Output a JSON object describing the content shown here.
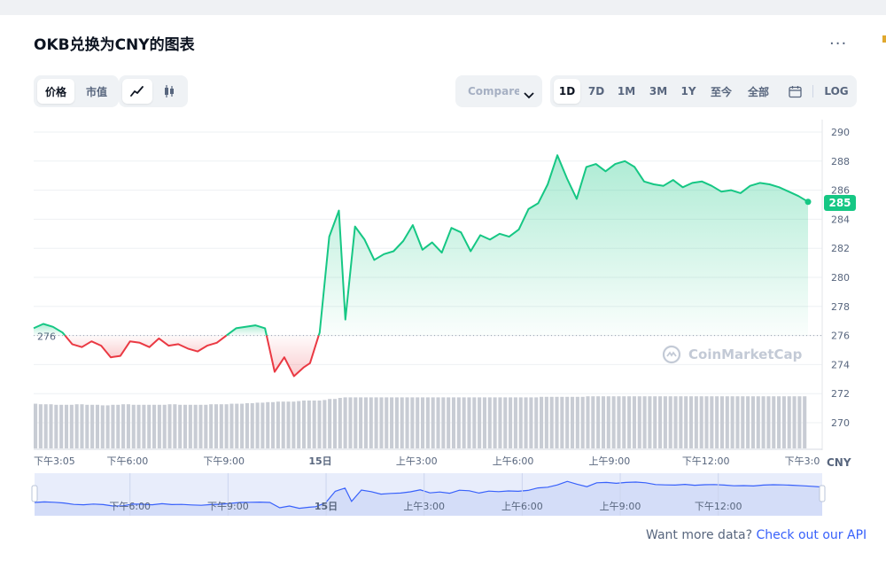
{
  "title": "OKB兑换为CNY的图表",
  "more_label": "...",
  "controls": {
    "metric_tabs": [
      "价格",
      "市值"
    ],
    "active_metric": "价格",
    "chart_style_icons": [
      "line-chart-icon",
      "candlestick-icon"
    ],
    "compare_placeholder": "Compare with",
    "range_tabs": [
      "1D",
      "7D",
      "1M",
      "3M",
      "1Y",
      "至今",
      "全部"
    ],
    "active_range": "1D",
    "log_label": "LOG"
  },
  "watermark": "CoinMarketCap",
  "footer": {
    "text": "Want more data? ",
    "link": "Check out our API"
  },
  "colors": {
    "up": "#16c784",
    "down": "#ea3943",
    "accent": "#3861fb",
    "volume": "#c8ccd4",
    "navigator": "#e8edfb"
  },
  "chart_data": {
    "type": "line",
    "currency": "CNY",
    "baseline": 276,
    "baseline_label": "276",
    "current_price": 285,
    "current_price_label": "285",
    "ylim": [
      268,
      291
    ],
    "y_ticks": [
      270,
      272,
      274,
      276,
      278,
      280,
      282,
      284,
      286,
      288,
      290
    ],
    "x_tick_labels": [
      "下午3:05",
      "下午6:00",
      "下午9:00",
      "15日",
      "上午3:00",
      "上午6:00",
      "上午9:00",
      "下午12:00",
      "下午3:0"
    ],
    "x_tick_hours": [
      0,
      2.92,
      5.92,
      8.92,
      11.92,
      14.92,
      17.92,
      20.92,
      23.92
    ],
    "x_hours": [
      0,
      0.3,
      0.6,
      0.9,
      1.2,
      1.5,
      1.8,
      2.1,
      2.4,
      2.7,
      3.0,
      3.3,
      3.6,
      3.9,
      4.2,
      4.5,
      4.8,
      5.1,
      5.4,
      5.7,
      6.0,
      6.3,
      6.6,
      6.9,
      7.2,
      7.5,
      7.8,
      8.1,
      8.4,
      8.6,
      8.9,
      9.2,
      9.5,
      9.7,
      10.0,
      10.3,
      10.6,
      10.9,
      11.2,
      11.5,
      11.8,
      12.1,
      12.4,
      12.7,
      13.0,
      13.3,
      13.6,
      13.9,
      14.2,
      14.5,
      14.8,
      15.1,
      15.4,
      15.7,
      16.0,
      16.3,
      16.6,
      16.9,
      17.2,
      17.5,
      17.8,
      18.1,
      18.4,
      18.7,
      19.0,
      19.3,
      19.6,
      19.9,
      20.2,
      20.5,
      20.8,
      21.1,
      21.4,
      21.7,
      22.0,
      22.3,
      22.6,
      22.9,
      23.2,
      23.5,
      23.8,
      24.1
    ],
    "y_values": [
      276.5,
      276.8,
      276.6,
      276.2,
      275.4,
      275.2,
      275.6,
      275.3,
      274.5,
      274.6,
      275.6,
      275.5,
      275.2,
      275.8,
      275.3,
      275.4,
      275.1,
      274.9,
      275.3,
      275.5,
      276.0,
      276.5,
      276.6,
      276.7,
      276.5,
      273.5,
      274.5,
      273.2,
      273.8,
      274.1,
      276.2,
      282.8,
      284.6,
      277.1,
      283.5,
      282.6,
      281.2,
      281.6,
      281.8,
      282.5,
      283.6,
      281.9,
      282.4,
      281.7,
      283.4,
      283.1,
      281.8,
      282.9,
      282.6,
      283.0,
      282.8,
      283.3,
      284.7,
      285.1,
      286.4,
      288.4,
      286.8,
      285.4,
      287.6,
      287.8,
      287.3,
      287.8,
      288.0,
      287.6,
      286.6,
      286.4,
      286.3,
      286.7,
      286.2,
      286.5,
      286.6,
      286.3,
      285.9,
      286.0,
      285.8,
      286.3,
      286.5,
      286.4,
      286.2,
      285.9,
      285.6,
      285.2
    ],
    "volume_relative": [
      0.84,
      0.83,
      0.83,
      0.82,
      0.82,
      0.83,
      0.82,
      0.82,
      0.81,
      0.82,
      0.83,
      0.82,
      0.82,
      0.82,
      0.82,
      0.83,
      0.82,
      0.82,
      0.82,
      0.83,
      0.83,
      0.84,
      0.84,
      0.85,
      0.86,
      0.87,
      0.88,
      0.88,
      0.89,
      0.9,
      0.9,
      0.91,
      0.93,
      0.95,
      0.96,
      0.96,
      0.96,
      0.96,
      0.96,
      0.96,
      0.96,
      0.96,
      0.96,
      0.96,
      0.96,
      0.96,
      0.96,
      0.96,
      0.96,
      0.96,
      0.96,
      0.96,
      0.96,
      0.96,
      0.97,
      0.97,
      0.97,
      0.97,
      0.97,
      0.98,
      0.98,
      0.98,
      0.98,
      0.98,
      0.98,
      0.98,
      0.98,
      0.98,
      0.98,
      0.98,
      0.98,
      0.98,
      0.98,
      0.98,
      0.98,
      0.98,
      0.98,
      0.98,
      0.98,
      0.98,
      0.98,
      0.98
    ],
    "navigator_tick_labels": [
      "下午6:00",
      "下午9:00",
      "15日",
      "上午3:00",
      "上午6:00",
      "上午9:00",
      "下午12:00"
    ],
    "navigator_tick_hours": [
      2.92,
      5.92,
      8.92,
      11.92,
      14.92,
      17.92,
      20.92
    ]
  }
}
